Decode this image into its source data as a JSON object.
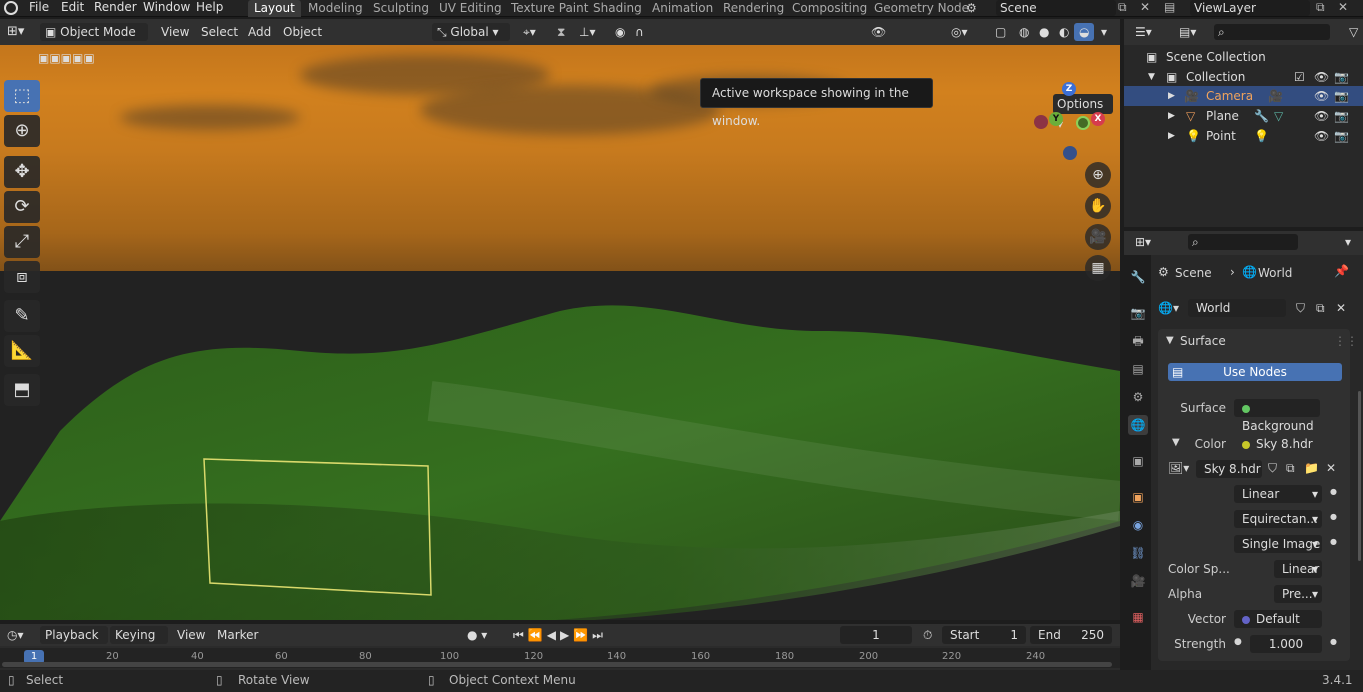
{
  "topbar": {
    "menus": [
      "File",
      "Edit",
      "Render",
      "Window",
      "Help"
    ],
    "workspaces": [
      "Layout",
      "Modeling",
      "Sculpting",
      "UV Editing",
      "Texture Paint",
      "Shading",
      "Animation",
      "Rendering",
      "Compositing",
      "Geometry Node"
    ],
    "active_workspace": "Layout",
    "scene_name": "Scene",
    "view_layer": "ViewLayer"
  },
  "viewport_header": {
    "mode": "Object Mode",
    "menus": [
      "View",
      "Select",
      "Add",
      "Object"
    ],
    "transform_orientation": "Global",
    "options_label": "Options"
  },
  "tooltip": "Active workspace showing in the window.",
  "gizmo": {
    "z": "Z",
    "y": "Y",
    "x": "X"
  },
  "timeline": {
    "menus": [
      "Playback",
      "Keying",
      "View",
      "Marker"
    ],
    "current_frame": "1",
    "start_label": "Start",
    "start": "1",
    "end_label": "End",
    "end": "250",
    "ruler_ticks": [
      "1",
      "20",
      "40",
      "60",
      "80",
      "100",
      "120",
      "140",
      "160",
      "180",
      "200",
      "220",
      "240"
    ]
  },
  "statusbar": {
    "select": "Select",
    "rotate": "Rotate View",
    "context": "Object Context Menu",
    "version": "3.4.1"
  },
  "outliner": {
    "scene_collection": "Scene Collection",
    "collection": "Collection",
    "items": [
      "Camera",
      "Plane",
      "Point"
    ]
  },
  "properties": {
    "breadcrumb_scene": "Scene",
    "breadcrumb_world": "World",
    "world_name": "World",
    "panel_title": "Surface",
    "use_nodes": "Use Nodes",
    "surface_label": "Surface",
    "surface_value": "Background",
    "color_label": "Color",
    "color_value": "Sky 8.hdr",
    "image_name": "Sky 8.hdr",
    "interpolation": "Linear",
    "projection": "Equirectan...",
    "source": "Single Image",
    "color_space_label": "Color Sp...",
    "color_space_value": "Linear",
    "alpha_label": "Alpha",
    "alpha_value": "Pre...",
    "vector_label": "Vector",
    "vector_value": "Default",
    "strength_label": "Strength",
    "strength_value": "1.000"
  }
}
